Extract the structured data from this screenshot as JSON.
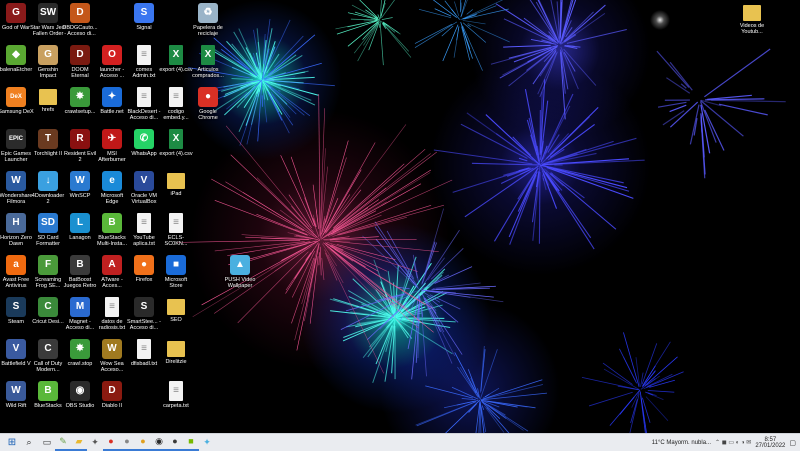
{
  "desktop": {
    "icons": [
      {
        "label": "God of War",
        "glyph": "G",
        "color": "#8a1a1a"
      },
      {
        "label": "Star Wars Jedi Fallen Order",
        "glyph": "SW",
        "color": "#2a2a2a"
      },
      {
        "label": "DBDGCauto... - Acceso di...",
        "glyph": "D",
        "color": "#c4571a"
      },
      {
        "label": "Signal",
        "glyph": "S",
        "color": "#3a76f0"
      },
      {
        "label": "Papelera de reciclaje",
        "glyph": "♻",
        "color": "#9ab4c8"
      },
      {
        "label": "Videos de Youtub...",
        "glyph": "",
        "color": "#e8c250"
      },
      {
        "label": "balenaEtcher",
        "glyph": "◆",
        "color": "#5aa832"
      },
      {
        "label": "Genshin Impact",
        "glyph": "G",
        "color": "#c9a060"
      },
      {
        "label": "DOOM Eternal",
        "glyph": "D",
        "color": "#7a1a10"
      },
      {
        "label": "launcher - Acceso ...",
        "glyph": "O",
        "color": "#d32020"
      },
      {
        "label": "comes Admin.txt",
        "glyph": "≡",
        "color": "#f3f3f3"
      },
      {
        "label": "export (4).csv",
        "glyph": "X",
        "color": "#1d8b44"
      },
      {
        "label": "Articulos comprados...",
        "glyph": "X",
        "color": "#1d8b44"
      },
      {
        "label": "Samsung DeX",
        "glyph": "DeX",
        "color": "#f08020"
      },
      {
        "label": "hrefs",
        "glyph": "",
        "color": "#e8c250"
      },
      {
        "label": "crawlsetup...",
        "glyph": "✸",
        "color": "#3a9a3a"
      },
      {
        "label": "Battle.net",
        "glyph": "✦",
        "color": "#1a6bd8"
      },
      {
        "label": "BlackDesert - Acceso di...",
        "glyph": "≡",
        "color": "#f3f3f3"
      },
      {
        "label": "codigo embed.y...",
        "glyph": "≡",
        "color": "#f3f3f3"
      },
      {
        "label": "Google Chrome",
        "glyph": "●",
        "color": "#d93025"
      },
      {
        "label": "Epic Games Launcher",
        "glyph": "EPIC",
        "color": "#2b2b2b"
      },
      {
        "label": "Torchlight II",
        "glyph": "T",
        "color": "#6a3a20"
      },
      {
        "label": "Resident Evil 2",
        "glyph": "R",
        "color": "#8a1010"
      },
      {
        "label": "MSI Afterburner",
        "glyph": "✈",
        "color": "#c01818"
      },
      {
        "label": "WhatsApp",
        "glyph": "✆",
        "color": "#25d366"
      },
      {
        "label": "export (4).csv",
        "glyph": "X",
        "color": "#1d8b44"
      },
      {
        "label": "Wondershare Filmora",
        "glyph": "W",
        "color": "#2a5aa0"
      },
      {
        "label": "4Downloader 2",
        "glyph": "↓",
        "color": "#3aa0e0"
      },
      {
        "label": "WinSCP",
        "glyph": "W",
        "color": "#2a7ad0"
      },
      {
        "label": "Microsoft Edge",
        "glyph": "e",
        "color": "#1a8ad8"
      },
      {
        "label": "Oracle VM VirtualBox",
        "glyph": "V",
        "color": "#2a4a9a"
      },
      {
        "label": "iPad",
        "glyph": "",
        "color": "#e8c250"
      },
      {
        "label": "Horizon Zero Dawn",
        "glyph": "H",
        "color": "#4a6a9a"
      },
      {
        "label": "SD Card Formatter",
        "glyph": "SD",
        "color": "#2a7ad0"
      },
      {
        "label": "Lanagon",
        "glyph": "L",
        "color": "#1a90d0"
      },
      {
        "label": "BlueStacks Multi-Insta...",
        "glyph": "B",
        "color": "#5ab83a"
      },
      {
        "label": "YouTube aplica.txt",
        "glyph": "≡",
        "color": "#f3f3f3"
      },
      {
        "label": "ECLS-SC0KN...",
        "glyph": "≡",
        "color": "#f3f3f3"
      },
      {
        "label": "Avast Free Antivirus",
        "glyph": "a",
        "color": "#f06a10"
      },
      {
        "label": "Screaming Frog SE...",
        "glyph": "F",
        "color": "#4a9a3a"
      },
      {
        "label": "BatBoost Juegos Retro",
        "glyph": "B",
        "color": "#3a3a3a"
      },
      {
        "label": "ATware - Acces...",
        "glyph": "A",
        "color": "#c02020"
      },
      {
        "label": "Firefox",
        "glyph": "●",
        "color": "#f0701a"
      },
      {
        "label": "Microsoft Store",
        "glyph": "■",
        "color": "#1a6bd8"
      },
      {
        "label": "PUSH Video Wallpaper",
        "glyph": "▲",
        "color": "#4ab0e0"
      },
      {
        "label": "Steam",
        "glyph": "S",
        "color": "#1a3a5a"
      },
      {
        "label": "Cricut Desi...",
        "glyph": "C",
        "color": "#3a8a3a"
      },
      {
        "label": "Magnet - Acceso di...",
        "glyph": "M",
        "color": "#2a6ad0"
      },
      {
        "label": "datos de radiosis.txt",
        "glyph": "≡",
        "color": "#f3f3f3"
      },
      {
        "label": "SmartStee... - Acceso di...",
        "glyph": "S",
        "color": "#2a2a2a"
      },
      {
        "label": "SEO",
        "glyph": "",
        "color": "#e8c250"
      },
      {
        "label": "Battlefield V",
        "glyph": "V",
        "color": "#3a5aa0"
      },
      {
        "label": "Call of Duty Modern...",
        "glyph": "C",
        "color": "#3a3a3a"
      },
      {
        "label": "crawl.stop",
        "glyph": "✸",
        "color": "#3a9a3a"
      },
      {
        "label": "Wow Sea Acceso...",
        "glyph": "W",
        "color": "#a07a20"
      },
      {
        "label": "dfisbadl.txt",
        "glyph": "≡",
        "color": "#f3f3f3"
      },
      {
        "label": "Direlitzie",
        "glyph": "",
        "color": "#e8c250"
      },
      {
        "label": "Wild Rift",
        "glyph": "W",
        "color": "#3a5a9a"
      },
      {
        "label": "BlueStacks",
        "glyph": "B",
        "color": "#5ab83a"
      },
      {
        "label": "OBS Studio",
        "glyph": "◉",
        "color": "#2a2a2a"
      },
      {
        "label": "Diablo II",
        "glyph": "D",
        "color": "#8a1a10"
      },
      {
        "label": "carpeta.txt",
        "glyph": "≡",
        "color": "#f3f3f3"
      }
    ]
  },
  "taskbar": {
    "start_glyph": "⊞",
    "search_glyph": "⌕",
    "apps": [
      {
        "name": "task-view-icon",
        "glyph": "▭",
        "color": "#333"
      },
      {
        "name": "notepad-icon",
        "glyph": "✎",
        "color": "#6aa04a"
      },
      {
        "name": "file-explorer-icon",
        "glyph": "▰",
        "color": "#e8b830"
      },
      {
        "name": "settings-icon",
        "glyph": "✦",
        "color": "#555"
      },
      {
        "name": "chrome-icon",
        "glyph": "●",
        "color": "#d93025"
      },
      {
        "name": "app-icon",
        "glyph": "●",
        "color": "#888"
      },
      {
        "name": "chrome-dev-icon",
        "glyph": "●",
        "color": "#e0a020"
      },
      {
        "name": "obs-icon",
        "glyph": "◉",
        "color": "#2a2a2a"
      },
      {
        "name": "chrome-canary-icon",
        "glyph": "●",
        "color": "#3a3a3a"
      },
      {
        "name": "nvidia-icon",
        "glyph": "■",
        "color": "#76b900"
      },
      {
        "name": "bird-icon",
        "glyph": "✦",
        "color": "#4ab0e0"
      }
    ],
    "weather": "11°C  Mayorm. nubla...",
    "time": "8:57",
    "date": "27/01/2022"
  }
}
